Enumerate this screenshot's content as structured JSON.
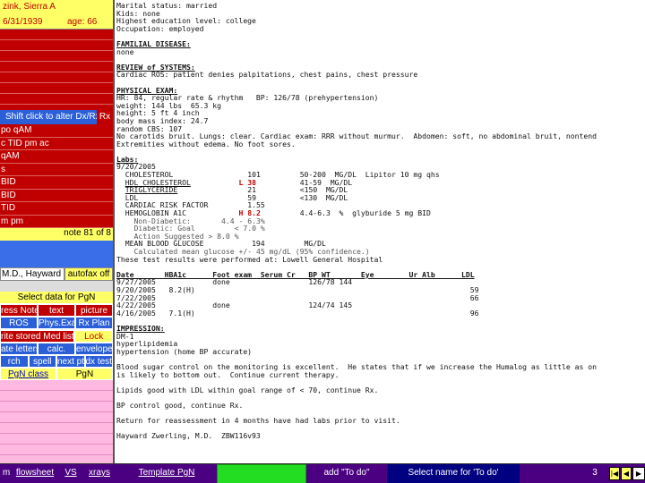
{
  "patient": {
    "name": "zink, Sierra A",
    "dob": "6/31/1939",
    "age": "age: 66"
  },
  "sidebar": {
    "dx_label": "Shift click to alter Dx/Rx",
    "rx_label": "Rx",
    "meds": [
      "po qAM",
      "c TID pm ac",
      "qAM",
      "s",
      "BID",
      "BID",
      "TID",
      "m pm"
    ],
    "note_count": "note 81 of 8",
    "provider": "M.D., Hayward",
    "autofax": "autofax off",
    "select_label": "Select data for PgN",
    "row1": [
      "ress Note:",
      "text",
      "picture"
    ],
    "row2": [
      "ROS",
      "Phys.Exam",
      "Rx Plan"
    ],
    "row3": [
      "rite stored Med list",
      "Lock"
    ],
    "row4": [
      "ate letters",
      "calc.",
      "envelope"
    ],
    "row5": [
      "rch",
      "spell",
      "next pt",
      "dx tests"
    ],
    "row6": [
      "PgN class",
      "PgN"
    ]
  },
  "note": {
    "lines_top": [
      "Marital status: married",
      "Kids: none",
      "Highest education level: college",
      "Occupation: employed"
    ],
    "familial_header": "FAMILIAL DISEASE:",
    "familial_body": "none",
    "ros_header": "REVIEW of SYSTEMS:",
    "ros_body": "Cardiac ROS: patient denies palpitations, chest pains, chest pressure",
    "pe_header": "PHYSICAL EXAM:",
    "pe_lines": [
      "HR: 84, regular rate & rhythm   BP: 126/78 (prehypertension)",
      "weight: 144 lbs  65.3 kg",
      "height: 5 ft 4 inch",
      "body mass index: 24.7",
      "random CBS: 107",
      "No carotids bruit. Lungs: clear. Cardiac exam: RRR without murmur.  Abdomen: soft, no abdominal bruit, nontend",
      "Extremities without edema. No foot sores."
    ],
    "labs_header": "Labs:",
    "labs_date": "9/20/2005",
    "lab_rows": [
      {
        "name": "CHOLESTEROL",
        "flag": "",
        "val": "101",
        "range": "50-200  MG/DL  Lipitor 10 mg qhs"
      },
      {
        "name": "HDL CHOLESTEROL",
        "flag": "L",
        "val": "38",
        "range": "41-59  MG/DL"
      },
      {
        "name": "TRIGLYCERIDE",
        "flag": "",
        "val": "21",
        "range": "<150  MG/DL"
      },
      {
        "name": "LDL",
        "flag": "",
        "val": "59",
        "range": "<130  MG/DL"
      },
      {
        "name": "CARDIAC RISK FACTOR",
        "flag": "",
        "val": "1.55",
        "range": ""
      },
      {
        "name": "HEMOGLOBIN A1C",
        "flag": "H",
        "val": "8.2",
        "range": "4.4-6.3  %  glyburide 5 mg BID"
      }
    ],
    "a1c_notes": [
      "Non-Diabetic:       4.4 - 6.3%",
      "Diabetic: Goal         < 7.0 %",
      "Action Suggested > 8.0 %"
    ],
    "mbg_row": "MEAN BLOOD GLUCOSE           194         MG/DL",
    "mbg_note": "Calculated mean glucose +/- 45 mg/dL (95% confidence.)",
    "performed_at": "These test results were performed at: Lowell General Hospital",
    "flow_header": "Date       HBA1c      Foot exam  Serum Cr   BP WT       Eye        Ur Alb      LDL",
    "flow_rows": [
      "9/27/2005             done                  126/78 144",
      "9/20/2005   8.2(H)                                                               59",
      "7/22/2005                                                                        66",
      "4/22/2005             done                  124/74 145",
      "4/16/2005   7.1(H)                                                               96"
    ],
    "impression_header": "IMPRESSION:",
    "impression_lines": [
      "DM-1",
      "hyperlipidemia",
      "hypertension (home BP accurate)"
    ],
    "plan_paragraphs": [
      "Blood sugar control on the monitoring is excellent.  He states that if we increase the Humalog as little as on",
      "is likely to bottom out.  Continue current therapy."
    ],
    "plan_lipids": "Lipids good with LDL within goal range of < 70, continue Rx.",
    "plan_bp": "BP control good, continue Rx.",
    "plan_return": "Return for reassessment in 4 months have had labs prior to visit.",
    "signature": "Hayward Zwerling, M.D.  ZBW116v93"
  },
  "bottom_bar": {
    "m": "m",
    "flowsheet": "flowsheet",
    "vs": "VS",
    "xrays": "xrays",
    "template": "Template PgN",
    "green": "",
    "todo": "add \"To do\"",
    "select_todo": "Select name for 'To do'",
    "number": "3"
  },
  "colors": {
    "red": "#c00000",
    "yellow": "#ffff66",
    "blue": "#2a5fd8",
    "purple": "#4b0082",
    "pink": "#ffb8e0"
  }
}
